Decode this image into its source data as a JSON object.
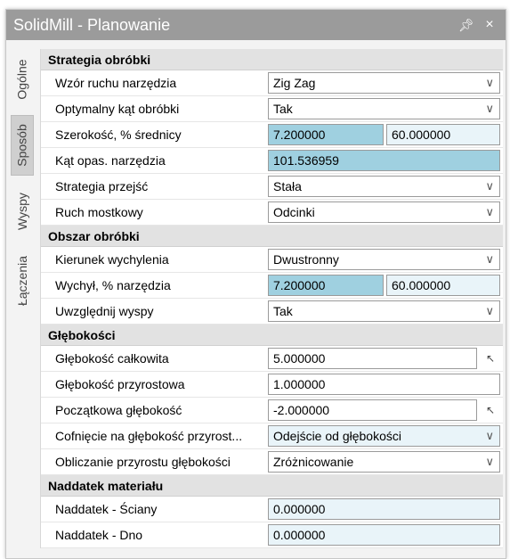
{
  "window": {
    "title": "SolidMill - Planowanie",
    "pin_glyph": "Ͱ",
    "close_glyph": "×"
  },
  "tabs": [
    {
      "label": "Ogólne",
      "active": false
    },
    {
      "label": "Sposób",
      "active": true
    },
    {
      "label": "Wyspy",
      "active": false
    },
    {
      "label": "Łączenia",
      "active": false
    }
  ],
  "categories": {
    "strategia": {
      "title": "Strategia obróbki",
      "rows": [
        {
          "label": "Wzór ruchu narzędzia",
          "value": "Zig Zag"
        },
        {
          "label": "Optymalny kąt obróbki",
          "value": "Tak"
        },
        {
          "label": "Szerokość, % średnicy",
          "value": "7.200000",
          "value2": "60.000000"
        },
        {
          "label": "Kąt opas. narzędzia",
          "value": "101.536959"
        },
        {
          "label": "Strategia przejść",
          "value": "Stała"
        },
        {
          "label": "Ruch mostkowy",
          "value": "Odcinki"
        }
      ]
    },
    "obszar": {
      "title": "Obszar obróbki",
      "rows": [
        {
          "label": "Kierunek wychylenia",
          "value": "Dwustronny"
        },
        {
          "label": "Wychył, % narzędzia",
          "value": "7.200000",
          "value2": "60.000000"
        },
        {
          "label": "Uwzględnij wyspy",
          "value": "Tak"
        }
      ]
    },
    "glebokosci": {
      "title": "Głębokości",
      "rows": [
        {
          "label": "Głębokość całkowita",
          "value": "5.000000"
        },
        {
          "label": "Głębokość przyrostowa",
          "value": "1.000000"
        },
        {
          "label": "Początkowa głębokość",
          "value": "-2.000000"
        },
        {
          "label": "Cofnięcie na głębokość przyrost...",
          "value": "Odejście od głębokości"
        },
        {
          "label": "Obliczanie przyrostu głębokości",
          "value": "Zróżnicowanie"
        }
      ]
    },
    "naddatek": {
      "title": "Naddatek materiału",
      "rows": [
        {
          "label": "Naddatek - Ściany",
          "value": "0.000000"
        },
        {
          "label": "Naddatek -  Dno",
          "value": "0.000000"
        }
      ]
    }
  },
  "colors": {
    "highlight": "#9fd0e0",
    "tinted": "#e9f4f9",
    "titlebar": "#9b9b9b"
  }
}
